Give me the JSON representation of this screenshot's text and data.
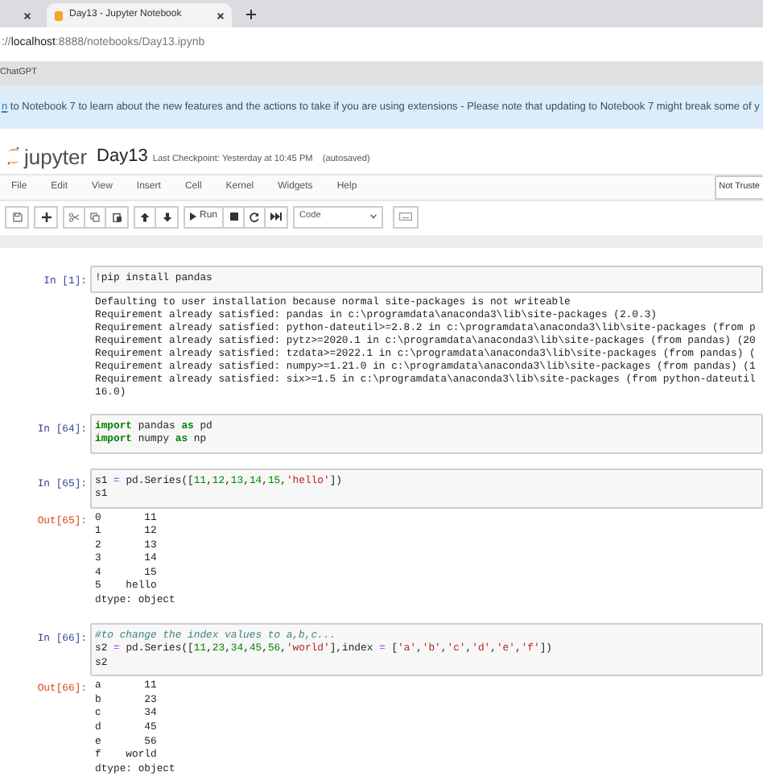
{
  "browser": {
    "tabs": [
      {
        "selected": false
      },
      {
        "title": "Day13 - Jupyter Notebook",
        "selected": true
      }
    ],
    "address": {
      "prefix": "://",
      "host": "localhost",
      "rest": ":8888/notebooks/Day13.ipynb"
    },
    "bookmarks": [
      "ChatGPT"
    ],
    "banner": {
      "link": "n",
      "text": " to Notebook 7 to learn about the new features and the actions to take if you are using extensions - Please note that updating to Notebook 7 might break some of y"
    }
  },
  "header": {
    "logo_text": "jupyter",
    "notebook_name": "Day13",
    "checkpoint": "Last Checkpoint: Yesterday at 10:45 PM",
    "autosave": "(autosaved)"
  },
  "menu": [
    "File",
    "Edit",
    "View",
    "Insert",
    "Cell",
    "Kernel",
    "Widgets",
    "Help"
  ],
  "trust": "Not Truste",
  "toolbar": {
    "run_label": "Run",
    "cell_type": "Code"
  },
  "cells": [
    {
      "prompt": "In [1]:",
      "input": [
        [
          {
            "text": "!pip install pandas",
            "kind": "plain"
          }
        ]
      ],
      "output": [
        "Defaulting to user installation because normal site-packages is not writeable",
        "Requirement already satisfied: pandas in c:\\programdata\\anaconda3\\lib\\site-packages (2.0.3)",
        "Requirement already satisfied: python-dateutil>=2.8.2 in c:\\programdata\\anaconda3\\lib\\site-packages (from p",
        "Requirement already satisfied: pytz>=2020.1 in c:\\programdata\\anaconda3\\lib\\site-packages (from pandas) (20",
        "Requirement already satisfied: tzdata>=2022.1 in c:\\programdata\\anaconda3\\lib\\site-packages (from pandas) (",
        "Requirement already satisfied: numpy>=1.21.0 in c:\\programdata\\anaconda3\\lib\\site-packages (from pandas) (1",
        "Requirement already satisfied: six>=1.5 in c:\\programdata\\anaconda3\\lib\\site-packages (from python-dateutil",
        "16.0)"
      ]
    },
    {
      "prompt": "In [64]:",
      "input": [
        [
          {
            "text": "import",
            "kind": "keyword"
          },
          {
            "text": " pandas ",
            "kind": "plain"
          },
          {
            "text": "as",
            "kind": "keyword"
          },
          {
            "text": " pd",
            "kind": "plain"
          }
        ],
        [
          {
            "text": "import",
            "kind": "keyword"
          },
          {
            "text": " numpy ",
            "kind": "plain"
          },
          {
            "text": "as",
            "kind": "keyword"
          },
          {
            "text": " np",
            "kind": "plain"
          }
        ]
      ]
    },
    {
      "prompt": "In [65]:",
      "input": [
        [
          {
            "text": "s1 ",
            "kind": "plain"
          },
          {
            "text": "=",
            "kind": "operator"
          },
          {
            "text": " pd.Series([",
            "kind": "plain"
          },
          {
            "text": "11",
            "kind": "number"
          },
          {
            "text": ",",
            "kind": "plain"
          },
          {
            "text": "12",
            "kind": "number"
          },
          {
            "text": ",",
            "kind": "plain"
          },
          {
            "text": "13",
            "kind": "number"
          },
          {
            "text": ",",
            "kind": "plain"
          },
          {
            "text": "14",
            "kind": "number"
          },
          {
            "text": ",",
            "kind": "plain"
          },
          {
            "text": "15",
            "kind": "number"
          },
          {
            "text": ",",
            "kind": "plain"
          },
          {
            "text": "'hello'",
            "kind": "string"
          },
          {
            "text": "])",
            "kind": "plain"
          }
        ],
        [
          {
            "text": "s1",
            "kind": "plain"
          }
        ]
      ],
      "out_prompt": "Out[65]:",
      "output": [
        "0       11",
        "1       12",
        "2       13",
        "3       14",
        "4       15",
        "5    hello",
        "dtype: object"
      ]
    },
    {
      "prompt": "In [66]:",
      "input": [
        [
          {
            "text": "#to change the index values to a,b,c...",
            "kind": "comment"
          }
        ],
        [
          {
            "text": "s2 ",
            "kind": "plain"
          },
          {
            "text": "=",
            "kind": "operator"
          },
          {
            "text": " pd.Series([",
            "kind": "plain"
          },
          {
            "text": "11",
            "kind": "number"
          },
          {
            "text": ",",
            "kind": "plain"
          },
          {
            "text": "23",
            "kind": "number"
          },
          {
            "text": ",",
            "kind": "plain"
          },
          {
            "text": "34",
            "kind": "number"
          },
          {
            "text": ",",
            "kind": "plain"
          },
          {
            "text": "45",
            "kind": "number"
          },
          {
            "text": ",",
            "kind": "plain"
          },
          {
            "text": "56",
            "kind": "number"
          },
          {
            "text": ",",
            "kind": "plain"
          },
          {
            "text": "'world'",
            "kind": "string"
          },
          {
            "text": "],index ",
            "kind": "plain"
          },
          {
            "text": "=",
            "kind": "operator"
          },
          {
            "text": " [",
            "kind": "plain"
          },
          {
            "text": "'a'",
            "kind": "string"
          },
          {
            "text": ",",
            "kind": "plain"
          },
          {
            "text": "'b'",
            "kind": "string"
          },
          {
            "text": ",",
            "kind": "plain"
          },
          {
            "text": "'c'",
            "kind": "string"
          },
          {
            "text": ",",
            "kind": "plain"
          },
          {
            "text": "'d'",
            "kind": "string"
          },
          {
            "text": ",",
            "kind": "plain"
          },
          {
            "text": "'e'",
            "kind": "string"
          },
          {
            "text": ",",
            "kind": "plain"
          },
          {
            "text": "'f'",
            "kind": "string"
          },
          {
            "text": "])",
            "kind": "plain"
          }
        ],
        [
          {
            "text": "s2",
            "kind": "plain"
          }
        ]
      ],
      "out_prompt": "Out[66]:",
      "output": [
        "a       11",
        "b       23",
        "c       34",
        "d       45",
        "e       56",
        "f    world",
        "dtype: object"
      ]
    }
  ]
}
